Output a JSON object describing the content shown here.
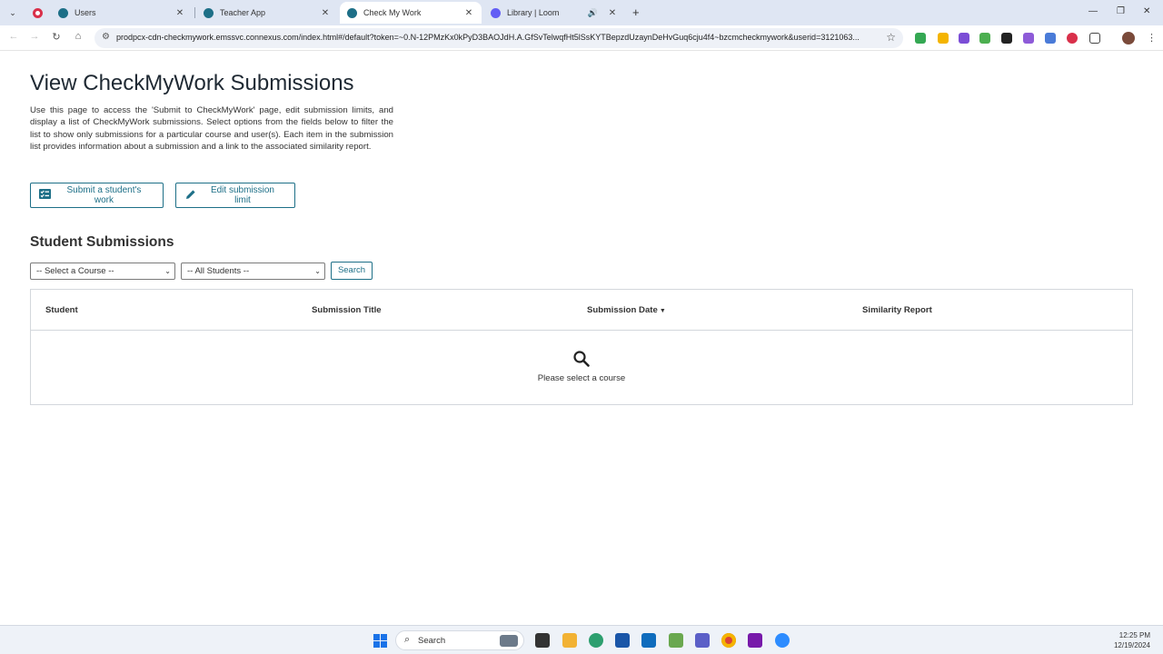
{
  "browser": {
    "tabs": [
      {
        "title": "",
        "favicon_color": "#d9304a",
        "icon": "record-icon"
      },
      {
        "title": "Users",
        "favicon_color": "#1d6f87",
        "icon": "connexus-icon"
      },
      {
        "title": "Teacher App",
        "favicon_color": "#1d6f87",
        "icon": "connexus-icon"
      },
      {
        "title": "Check My Work",
        "favicon_color": "#1d6f87",
        "icon": "connexus-icon",
        "active": true
      },
      {
        "title": "Library | Loom",
        "favicon_color": "#625df5",
        "icon": "loom-icon",
        "audio": true
      }
    ],
    "url": "prodpcx-cdn-checkmywork.emssvc.connexus.com/index.html#/default?token=~0.N-12PMzKx0kPyD3BAOJdH.A.GfSvTelwqfHt5lSsKYTBepzdUzaynDeHvGuq6cju4f4~bzcmcheckmywork&userid=3121063..."
  },
  "page": {
    "title": "View CheckMyWork Submissions",
    "intro": "Use this page to access the 'Submit to CheckMyWork' page, edit submission limits, and display a list of CheckMyWork submissions. Select options from the fields below to filter the list to show only submissions for a particular course and user(s). Each item in the submission list provides information about a submission and a link to the associated similarity report.",
    "buttons": {
      "submit_label": "Submit a student's work",
      "edit_label": "Edit submission limit"
    },
    "section_title": "Student Submissions",
    "filters": {
      "course_selected": "-- Select a Course --",
      "students_selected": "-- All Students --",
      "search_label": "Search"
    },
    "table": {
      "headers": [
        "Student",
        "Submission Title",
        "Submission Date",
        "Similarity Report"
      ],
      "empty_message": "Please select a course"
    }
  },
  "taskbar": {
    "search_label": "Search",
    "time": "12:25 PM",
    "date": "12/19/2024"
  },
  "colors": {
    "accent": "#1d6f87",
    "tab_strip": "#dfe6f3"
  }
}
